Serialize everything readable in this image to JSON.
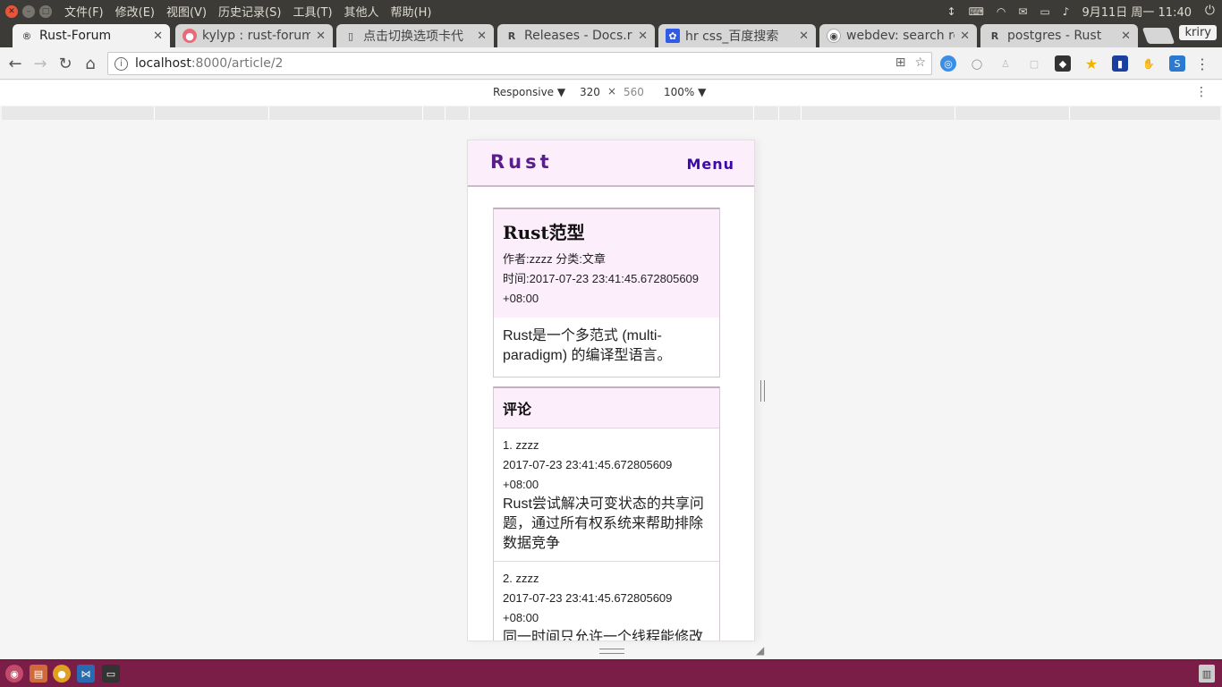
{
  "system": {
    "menus": [
      "文件(F)",
      "修改(E)",
      "视图(V)",
      "历史记录(S)",
      "工具(T)",
      "其他人",
      "帮助(H)"
    ],
    "clock": "9月11日 周一 11:40"
  },
  "tabs": [
    {
      "label": "Rust-Forum",
      "favicon": "rust-logo-icon",
      "active": true
    },
    {
      "label": "kylyp : rust-forum",
      "favicon": "github-icon",
      "active": false
    },
    {
      "label": "点击切换选项卡代",
      "favicon": "page-icon",
      "active": false
    },
    {
      "label": "Releases - Docs.rs",
      "favicon": "rust-logo-icon",
      "active": false
    },
    {
      "label": "hr css_百度搜索",
      "favicon": "baidu-icon",
      "active": false
    },
    {
      "label": "webdev: search re",
      "favicon": "reddit-icon",
      "active": false
    },
    {
      "label": "postgres - Rust",
      "favicon": "rust-logo-icon",
      "active": false
    }
  ],
  "user_button": "kriry",
  "address": {
    "host": "localhost",
    "path": ":8000/article/2"
  },
  "devtools": {
    "mode": "Responsive",
    "width": "320",
    "height": "560",
    "zoom": "100%"
  },
  "page": {
    "brand": "Rust",
    "menu": "Menu",
    "article": {
      "title": "Rust范型",
      "author_category": "作者:zzzz 分类:文章",
      "time": "时间:2017-07-23 23:41:45.672805609 +08:00",
      "content": "Rust是一个多范式 (multi-paradigm) 的编译型语言。"
    },
    "comments_title": "评论",
    "comments": [
      {
        "author": "1. zzzz",
        "time": "2017-07-23 23:41:45.672805609 +08:00",
        "text": "Rust尝试解决可变状态的共享问题，通过所有权系统来帮助排除数据竞争"
      },
      {
        "author": "2. zzzz",
        "time": "2017-07-23 23:41:45.672805609 +08:00",
        "text": "同一时间只允许一个线程能修改它的值，这一 mutex 线程方法"
      }
    ]
  }
}
